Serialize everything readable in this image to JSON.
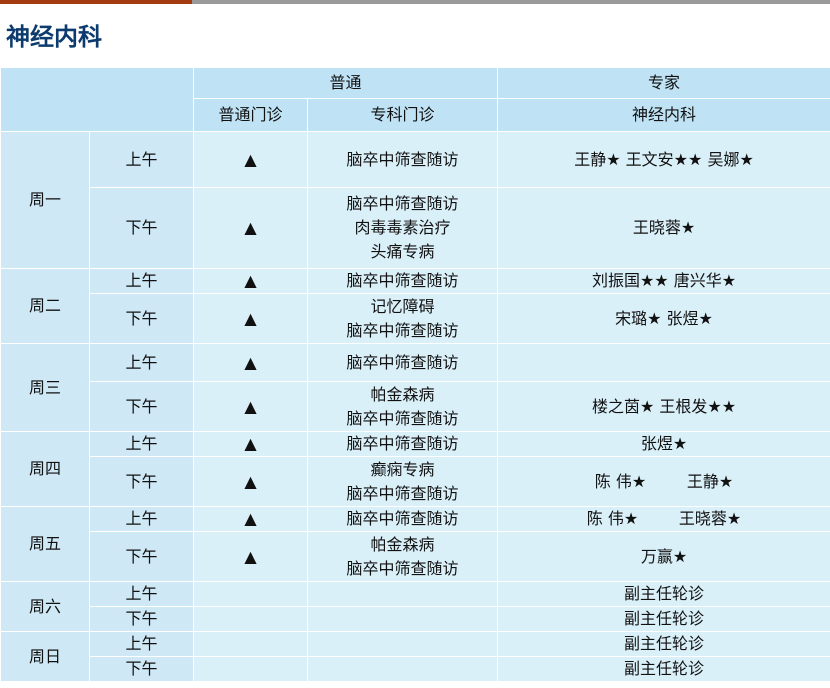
{
  "page": {
    "title": "神经内科"
  },
  "header": {
    "group_general": "普通",
    "group_expert": "专家",
    "col_general_clinic": "普通门诊",
    "col_special_clinic": "专科门诊",
    "col_expert_dept": "神经内科"
  },
  "schedule": [
    {
      "day": "周一",
      "sessions": [
        {
          "period": "上午",
          "general": "▲",
          "special": [
            "脑卒中筛查随访"
          ],
          "experts": "王静★ 王文安★★ 吴娜★"
        },
        {
          "period": "下午",
          "general": "▲",
          "special": [
            "脑卒中筛查随访",
            "肉毒毒素治疗",
            "头痛专病"
          ],
          "experts": "王晓蓉★"
        }
      ]
    },
    {
      "day": "周二",
      "sessions": [
        {
          "period": "上午",
          "general": "▲",
          "special": [
            "脑卒中筛查随访"
          ],
          "experts": "刘振国★★ 唐兴华★"
        },
        {
          "period": "下午",
          "general": "▲",
          "special": [
            "记忆障碍",
            "脑卒中筛查随访"
          ],
          "experts": "宋璐★ 张煜★"
        }
      ]
    },
    {
      "day": "周三",
      "sessions": [
        {
          "period": "上午",
          "general": "▲",
          "special": [
            "脑卒中筛查随访"
          ],
          "experts": ""
        },
        {
          "period": "下午",
          "general": "▲",
          "special": [
            "帕金森病",
            "脑卒中筛查随访"
          ],
          "experts": "楼之茵★ 王根发★★"
        }
      ]
    },
    {
      "day": "周四",
      "sessions": [
        {
          "period": "上午",
          "general": "▲",
          "special": [
            "脑卒中筛查随访"
          ],
          "experts": "张煜★"
        },
        {
          "period": "下午",
          "general": "▲",
          "special": [
            "癫痫专病",
            "脑卒中筛查随访"
          ],
          "experts": "陈 伟★        王静★"
        }
      ]
    },
    {
      "day": "周五",
      "sessions": [
        {
          "period": "上午",
          "general": "▲",
          "special": [
            "脑卒中筛查随访"
          ],
          "experts": "陈 伟★        王晓蓉★"
        },
        {
          "period": "下午",
          "general": "▲",
          "special": [
            "帕金森病",
            "脑卒中筛查随访"
          ],
          "experts": "万赢★"
        }
      ]
    },
    {
      "day": "周六",
      "sessions": [
        {
          "period": "上午",
          "general": "",
          "special": [],
          "experts": "副主任轮诊"
        },
        {
          "period": "下午",
          "general": "",
          "special": [],
          "experts": "副主任轮诊"
        }
      ]
    },
    {
      "day": "周日",
      "sessions": [
        {
          "period": "上午",
          "general": "",
          "special": [],
          "experts": "副主任轮诊"
        },
        {
          "period": "下午",
          "general": "",
          "special": [],
          "experts": "副主任轮诊"
        }
      ]
    }
  ]
}
